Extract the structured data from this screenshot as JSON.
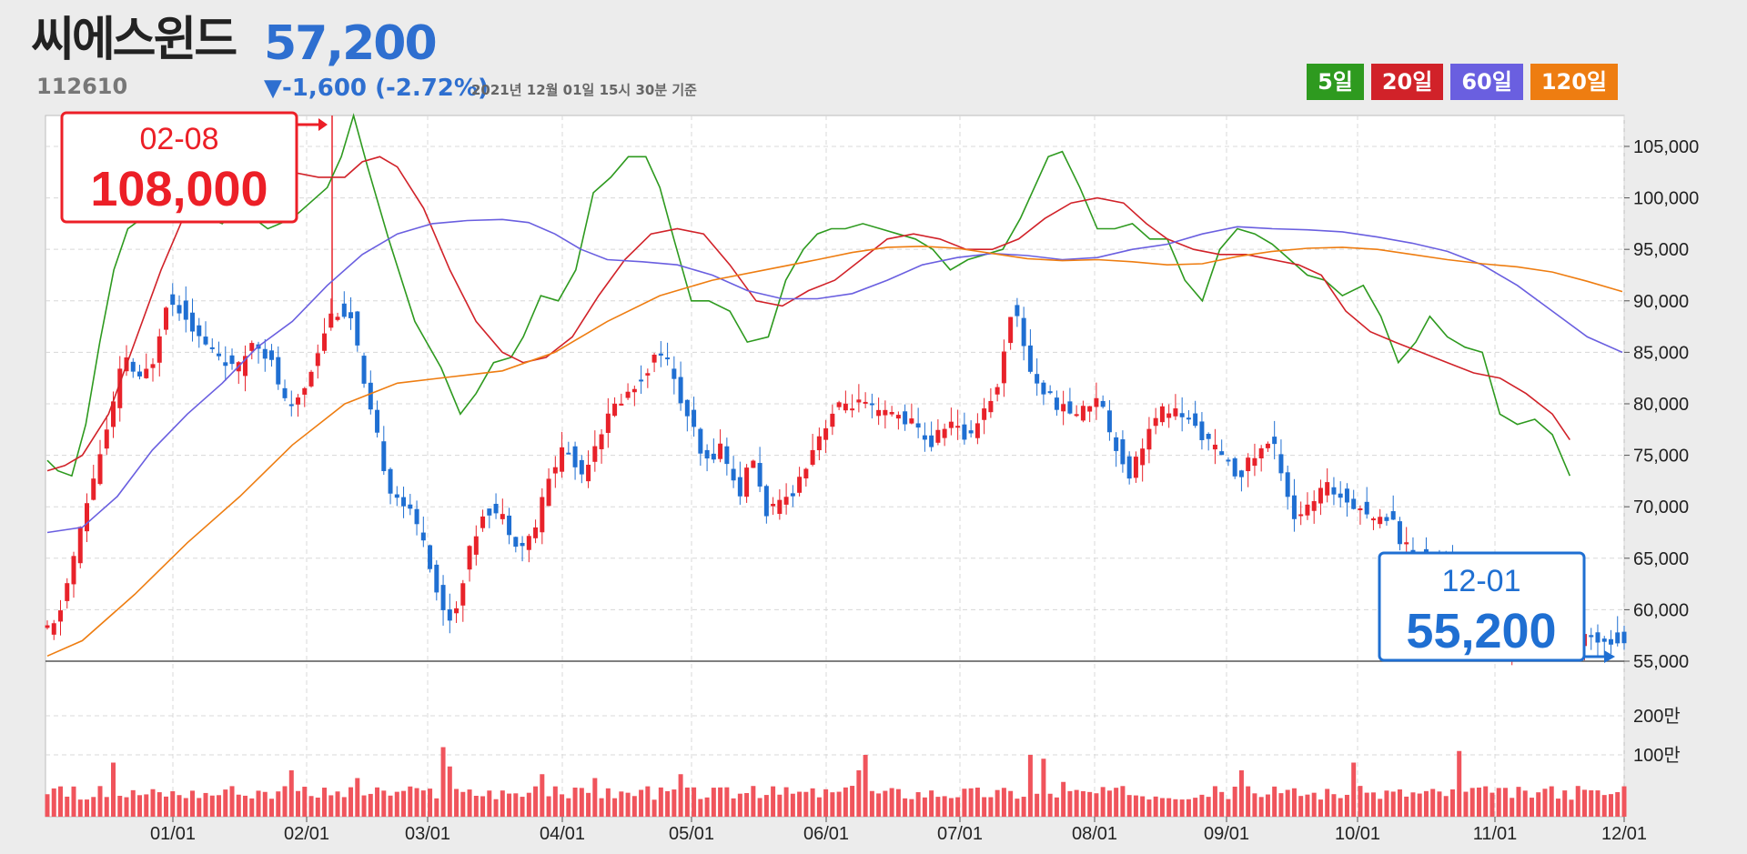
{
  "header": {
    "name": "씨에스윈드",
    "code": "112610",
    "price": "57,200",
    "change": "▼-1,600 (-2.72%)",
    "timestamp": "2021년 12월 01일 15시 30분 기준"
  },
  "legend": [
    {
      "label": "5일",
      "color": "#2e9a1f"
    },
    {
      "label": "20일",
      "color": "#d12229"
    },
    {
      "label": "60일",
      "color": "#6a5fe0"
    },
    {
      "label": "120일",
      "color": "#ee7d11"
    }
  ],
  "colors": {
    "up": "#e8222a",
    "down": "#1f6fd2",
    "volume": "#f0545c",
    "ma5": "#2e9a1f",
    "ma20": "#d12229",
    "ma60": "#6a5fe0",
    "ma120": "#ee7d11",
    "high_callout": "#ec1f27",
    "low_callout": "#1f6fd2"
  },
  "chart_data": {
    "type": "candlestick",
    "x_ticks": [
      "01/01",
      "02/01",
      "03/01",
      "04/01",
      "05/01",
      "06/01",
      "07/01",
      "08/01",
      "09/01",
      "10/01",
      "11/01",
      "12/01"
    ],
    "y_ticks": [
      "105,000",
      "100,000",
      "95,000",
      "90,000",
      "85,000",
      "80,000",
      "75,000",
      "70,000",
      "65,000",
      "60,000",
      "55,000"
    ],
    "ylim": [
      55000,
      108000
    ],
    "volume_ticks": [
      "200만",
      "100만"
    ],
    "high": {
      "date": "02-08",
      "value": "108,000",
      "price": 108000
    },
    "low": {
      "date": "12-01",
      "value": "55,200",
      "price": 55200
    },
    "close_series": [
      [
        0,
        58000
      ],
      [
        5,
        58500
      ],
      [
        12,
        63000
      ],
      [
        20,
        68500
      ],
      [
        28,
        74000
      ],
      [
        36,
        78500
      ],
      [
        44,
        85000
      ],
      [
        52,
        82000
      ],
      [
        60,
        84000
      ],
      [
        68,
        90000
      ],
      [
        78,
        89000
      ],
      [
        88,
        86000
      ],
      [
        100,
        84500
      ],
      [
        108,
        83000
      ],
      [
        118,
        86500
      ],
      [
        128,
        84000
      ],
      [
        138,
        79000
      ],
      [
        148,
        82000
      ],
      [
        158,
        87000
      ],
      [
        163,
        89000
      ],
      [
        168,
        89000
      ],
      [
        175,
        88000
      ],
      [
        180,
        82000
      ],
      [
        188,
        77000
      ],
      [
        195,
        72000
      ],
      [
        205,
        70000
      ],
      [
        215,
        67000
      ],
      [
        225,
        60000
      ],
      [
        232,
        59000
      ],
      [
        240,
        65000
      ],
      [
        250,
        70000
      ],
      [
        260,
        69000
      ],
      [
        270,
        66000
      ],
      [
        278,
        67500
      ],
      [
        285,
        72000
      ],
      [
        295,
        76000
      ],
      [
        305,
        73000
      ],
      [
        315,
        77000
      ],
      [
        325,
        80000
      ],
      [
        335,
        81500
      ],
      [
        345,
        84000
      ],
      [
        352,
        85500
      ],
      [
        360,
        81000
      ],
      [
        368,
        78000
      ],
      [
        375,
        74000
      ],
      [
        385,
        76000
      ],
      [
        395,
        71000
      ],
      [
        403,
        75000
      ],
      [
        410,
        69500
      ],
      [
        418,
        70000
      ],
      [
        428,
        72000
      ],
      [
        438,
        76000
      ],
      [
        448,
        79000
      ],
      [
        455,
        80000
      ],
      [
        465,
        80000
      ],
      [
        475,
        79000
      ],
      [
        485,
        79000
      ],
      [
        495,
        78000
      ],
      [
        505,
        76000
      ],
      [
        515,
        78500
      ],
      [
        525,
        76500
      ],
      [
        535,
        79500
      ],
      [
        543,
        81500
      ],
      [
        550,
        89000
      ],
      [
        555,
        88000
      ],
      [
        562,
        83000
      ],
      [
        570,
        81000
      ],
      [
        580,
        79500
      ],
      [
        590,
        79000
      ],
      [
        600,
        81000
      ],
      [
        608,
        77000
      ],
      [
        618,
        73000
      ],
      [
        628,
        77000
      ],
      [
        638,
        79500
      ],
      [
        648,
        79000
      ],
      [
        660,
        77000
      ],
      [
        670,
        75000
      ],
      [
        680,
        73000
      ],
      [
        690,
        75000
      ],
      [
        700,
        76500
      ],
      [
        707,
        72500
      ],
      [
        712,
        69000
      ],
      [
        722,
        70000
      ],
      [
        730,
        72000
      ],
      [
        740,
        71000
      ],
      [
        750,
        70000
      ],
      [
        760,
        68500
      ],
      [
        768,
        69500
      ],
      [
        772,
        67000
      ],
      [
        782,
        65000
      ],
      [
        792,
        65500
      ],
      [
        798,
        64500
      ],
      [
        808,
        64500
      ],
      [
        818,
        60000
      ],
      [
        825,
        60000
      ],
      [
        832,
        56000
      ],
      [
        837,
        57200
      ]
    ],
    "ma5": [
      [
        0,
        74500
      ],
      [
        6,
        73500
      ],
      [
        14,
        73000
      ],
      [
        22,
        78000
      ],
      [
        30,
        86000
      ],
      [
        38,
        93000
      ],
      [
        46,
        97000
      ],
      [
        54,
        98000
      ],
      [
        62,
        99000
      ],
      [
        72,
        100000
      ],
      [
        82,
        99000
      ],
      [
        92,
        98000
      ],
      [
        100,
        97500
      ],
      [
        108,
        99000
      ],
      [
        118,
        98000
      ],
      [
        126,
        97000
      ],
      [
        140,
        98000
      ],
      [
        150,
        99500
      ],
      [
        160,
        101000
      ],
      [
        168,
        104000
      ],
      [
        175,
        108000
      ],
      [
        183,
        103000
      ],
      [
        195,
        96000
      ],
      [
        210,
        88000
      ],
      [
        225,
        83500
      ],
      [
        236,
        79000
      ],
      [
        245,
        81000
      ],
      [
        255,
        84000
      ],
      [
        265,
        84500
      ],
      [
        272,
        86500
      ],
      [
        282,
        90500
      ],
      [
        292,
        90000
      ],
      [
        302,
        93000
      ],
      [
        312,
        100500
      ],
      [
        322,
        102000
      ],
      [
        332,
        104000
      ],
      [
        342,
        104000
      ],
      [
        350,
        101000
      ],
      [
        358,
        96000
      ],
      [
        368,
        90000
      ],
      [
        378,
        90000
      ],
      [
        390,
        89000
      ],
      [
        400,
        86000
      ],
      [
        412,
        86500
      ],
      [
        422,
        92000
      ],
      [
        432,
        95000
      ],
      [
        440,
        96500
      ],
      [
        448,
        97000
      ],
      [
        456,
        97000
      ],
      [
        466,
        97500
      ],
      [
        476,
        97000
      ],
      [
        486,
        96500
      ],
      [
        496,
        96000
      ],
      [
        506,
        95000
      ],
      [
        516,
        93000
      ],
      [
        526,
        94000
      ],
      [
        536,
        94500
      ],
      [
        546,
        95000
      ],
      [
        556,
        98000
      ],
      [
        564,
        101000
      ],
      [
        572,
        104000
      ],
      [
        580,
        104500
      ],
      [
        590,
        101000
      ],
      [
        600,
        97000
      ],
      [
        610,
        97000
      ],
      [
        620,
        97500
      ],
      [
        630,
        96000
      ],
      [
        640,
        96000
      ],
      [
        650,
        92000
      ],
      [
        660,
        90000
      ],
      [
        670,
        95000
      ],
      [
        680,
        97000
      ],
      [
        690,
        96500
      ],
      [
        700,
        95500
      ],
      [
        710,
        94000
      ],
      [
        720,
        92500
      ],
      [
        730,
        92000
      ],
      [
        740,
        90500
      ],
      [
        752,
        91500
      ],
      [
        762,
        88500
      ],
      [
        772,
        84000
      ],
      [
        782,
        86000
      ],
      [
        790,
        88500
      ],
      [
        800,
        86500
      ],
      [
        810,
        85500
      ],
      [
        820,
        85000
      ],
      [
        830,
        79000
      ],
      [
        840,
        78000
      ],
      [
        850,
        78500
      ],
      [
        860,
        77000
      ],
      [
        870,
        73000
      ]
    ],
    "ma20": [
      [
        0,
        73500
      ],
      [
        10,
        74000
      ],
      [
        20,
        75000
      ],
      [
        35,
        79000
      ],
      [
        50,
        86000
      ],
      [
        65,
        93000
      ],
      [
        80,
        99000
      ],
      [
        95,
        101000
      ],
      [
        110,
        101500
      ],
      [
        125,
        101000
      ],
      [
        140,
        102500
      ],
      [
        155,
        102000
      ],
      [
        170,
        102000
      ],
      [
        180,
        103500
      ],
      [
        190,
        104000
      ],
      [
        200,
        103000
      ],
      [
        215,
        99000
      ],
      [
        230,
        93000
      ],
      [
        245,
        88000
      ],
      [
        260,
        85000
      ],
      [
        272,
        84000
      ],
      [
        285,
        84500
      ],
      [
        300,
        86500
      ],
      [
        315,
        90500
      ],
      [
        330,
        94000
      ],
      [
        345,
        96500
      ],
      [
        360,
        97000
      ],
      [
        375,
        96500
      ],
      [
        390,
        93500
      ],
      [
        405,
        90000
      ],
      [
        420,
        89500
      ],
      [
        435,
        91000
      ],
      [
        450,
        92000
      ],
      [
        465,
        94000
      ],
      [
        480,
        96000
      ],
      [
        495,
        96500
      ],
      [
        510,
        96000
      ],
      [
        525,
        95000
      ],
      [
        540,
        95000
      ],
      [
        555,
        96000
      ],
      [
        570,
        98000
      ],
      [
        585,
        99500
      ],
      [
        600,
        100000
      ],
      [
        615,
        99500
      ],
      [
        628,
        97500
      ],
      [
        640,
        96000
      ],
      [
        655,
        95000
      ],
      [
        670,
        94500
      ],
      [
        685,
        94500
      ],
      [
        700,
        94000
      ],
      [
        715,
        93500
      ],
      [
        728,
        92500
      ],
      [
        742,
        89000
      ],
      [
        756,
        87000
      ],
      [
        770,
        86000
      ],
      [
        785,
        85000
      ],
      [
        800,
        84000
      ],
      [
        815,
        83000
      ],
      [
        830,
        82500
      ],
      [
        845,
        81000
      ],
      [
        860,
        79000
      ],
      [
        870,
        76500
      ]
    ],
    "ma60": [
      [
        0,
        67500
      ],
      [
        20,
        68000
      ],
      [
        40,
        71000
      ],
      [
        60,
        75500
      ],
      [
        80,
        79000
      ],
      [
        100,
        82000
      ],
      [
        120,
        85500
      ],
      [
        140,
        88000
      ],
      [
        160,
        91500
      ],
      [
        180,
        94500
      ],
      [
        200,
        96500
      ],
      [
        220,
        97500
      ],
      [
        240,
        97800
      ],
      [
        260,
        97900
      ],
      [
        275,
        97600
      ],
      [
        290,
        96500
      ],
      [
        305,
        95000
      ],
      [
        320,
        94000
      ],
      [
        340,
        93800
      ],
      [
        360,
        93500
      ],
      [
        380,
        92500
      ],
      [
        400,
        91000
      ],
      [
        420,
        90200
      ],
      [
        440,
        90200
      ],
      [
        460,
        90700
      ],
      [
        480,
        92000
      ],
      [
        500,
        93500
      ],
      [
        520,
        94200
      ],
      [
        540,
        94600
      ],
      [
        560,
        94400
      ],
      [
        580,
        94000
      ],
      [
        600,
        94200
      ],
      [
        620,
        95000
      ],
      [
        640,
        95500
      ],
      [
        660,
        96500
      ],
      [
        680,
        97200
      ],
      [
        700,
        97000
      ],
      [
        720,
        96900
      ],
      [
        740,
        96700
      ],
      [
        760,
        96200
      ],
      [
        780,
        95600
      ],
      [
        800,
        94800
      ],
      [
        820,
        93500
      ],
      [
        840,
        91500
      ],
      [
        860,
        89000
      ],
      [
        880,
        86500
      ],
      [
        900,
        85000
      ]
    ],
    "ma120": [
      [
        0,
        55500
      ],
      [
        20,
        57000
      ],
      [
        50,
        61500
      ],
      [
        80,
        66500
      ],
      [
        110,
        71000
      ],
      [
        140,
        76000
      ],
      [
        170,
        80000
      ],
      [
        200,
        82000
      ],
      [
        230,
        82600
      ],
      [
        260,
        83200
      ],
      [
        290,
        85000
      ],
      [
        320,
        88000
      ],
      [
        350,
        90500
      ],
      [
        380,
        92000
      ],
      [
        410,
        93000
      ],
      [
        440,
        94000
      ],
      [
        460,
        94700
      ],
      [
        480,
        95200
      ],
      [
        500,
        95300
      ],
      [
        520,
        95100
      ],
      [
        540,
        94600
      ],
      [
        560,
        94100
      ],
      [
        580,
        93900
      ],
      [
        600,
        94000
      ],
      [
        620,
        93800
      ],
      [
        640,
        93500
      ],
      [
        660,
        93600
      ],
      [
        680,
        94300
      ],
      [
        700,
        94800
      ],
      [
        720,
        95100
      ],
      [
        740,
        95200
      ],
      [
        760,
        95000
      ],
      [
        780,
        94500
      ],
      [
        800,
        94000
      ],
      [
        820,
        93600
      ],
      [
        840,
        93300
      ],
      [
        860,
        92800
      ],
      [
        880,
        91900
      ],
      [
        900,
        90900
      ]
    ],
    "volume_spikes": {
      "38": 0.9,
      "39": 0.7,
      "138": 0.95,
      "139": 0.85,
      "140": 0.6,
      "178": 0.5,
      "225": 0.8,
      "226": 0.95,
      "227": 1.0,
      "228": 0.9,
      "229": 0.7,
      "230": 0.65,
      "283": 0.55,
      "312": 0.5,
      "361": 0.55,
      "462": 0.9,
      "463": 0.6,
      "468": 0.8,
      "561": 1.25,
      "562": 0.8,
      "568": 0.75,
      "579": 0.45,
      "681": 0.6,
      "747": 0.7,
      "806": 0.85
    }
  }
}
